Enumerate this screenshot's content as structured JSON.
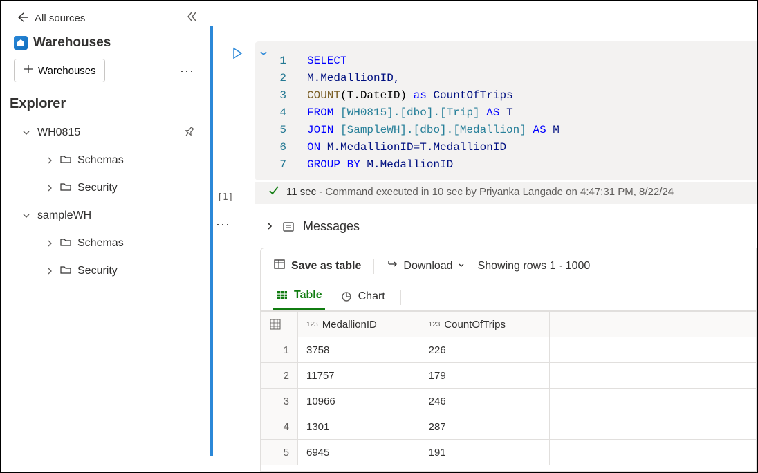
{
  "sidebar": {
    "back_label": "All sources",
    "title": "Warehouses",
    "add_label": "Warehouses",
    "explorer_label": "Explorer",
    "tree": [
      {
        "label": "WH0815",
        "expanded": true,
        "children": [
          {
            "label": "Schemas"
          },
          {
            "label": "Security"
          }
        ]
      },
      {
        "label": "sampleWH",
        "expanded": true,
        "children": [
          {
            "label": "Schemas"
          },
          {
            "label": "Security"
          }
        ]
      }
    ]
  },
  "editor": {
    "cell_index": "[1]",
    "sql": {
      "l1_select": "SELECT",
      "l2_expr": "M.MedallionID,",
      "l3_count": "COUNT",
      "l3_arg": "(T.DateID)",
      "l3_as": "as",
      "l3_alias": "CountOfTrips",
      "l4_from": "FROM",
      "l4_tbl": "[WH0815].[dbo].[Trip]",
      "l4_as": "AS",
      "l4_alias": "T",
      "l5_join": "JOIN",
      "l5_tbl": "[SampleWH].[dbo].[Medallion]",
      "l5_as": "AS",
      "l5_alias": "M",
      "l6_on": "ON",
      "l6_cond": "M.MedallionID=T.MedallionID",
      "l7_grp": "GROUP BY",
      "l7_expr": "M.MedallionID"
    },
    "status": {
      "duration": "11 sec",
      "tail": " - Command executed in 10 sec by Priyanka Langade on 4:47:31 PM, 8/22/24"
    }
  },
  "messages": {
    "label": "Messages"
  },
  "results": {
    "save_label": "Save as table",
    "download_label": "Download",
    "rows_label": "Showing rows 1 - 1000",
    "tabs": {
      "table": "Table",
      "chart": "Chart"
    },
    "columns": [
      "MedallionID",
      "CountOfTrips"
    ],
    "col_type_prefix": "123",
    "rows": [
      {
        "n": "1",
        "MedallionID": "3758",
        "CountOfTrips": "226"
      },
      {
        "n": "2",
        "MedallionID": "11757",
        "CountOfTrips": "179"
      },
      {
        "n": "3",
        "MedallionID": "10966",
        "CountOfTrips": "246"
      },
      {
        "n": "4",
        "MedallionID": "1301",
        "CountOfTrips": "287"
      },
      {
        "n": "5",
        "MedallionID": "6945",
        "CountOfTrips": "191"
      }
    ]
  }
}
